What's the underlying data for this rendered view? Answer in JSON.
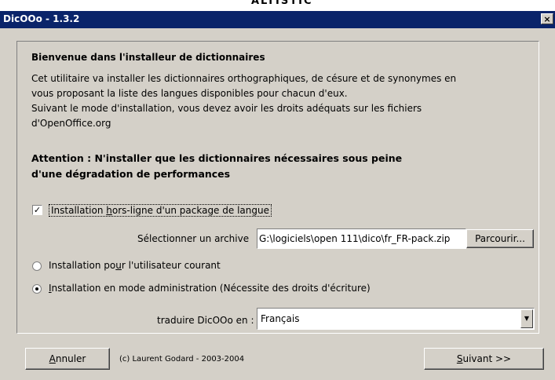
{
  "window": {
    "title": "DicOOo - 1.3.2",
    "close_label": "×",
    "top_strip_text": "ALTISTIC"
  },
  "main": {
    "heading": "Bienvenue dans l'installeur de dictionnaires",
    "description_lines": [
      "Cet utilitaire va installer les dictionnaires orthographiques, de césure et de synonymes en",
      "vous proposant la liste des langues disponibles pour chacun d'eux.",
      "Suivant le mode d'installation, vous devez avoir les droits adéquats sur les fichiers",
      "d'OpenOffice.org"
    ],
    "warning_lines": [
      "Attention : N'installer que les dictionnaires nécessaires sous peine",
      "d'une dégradation de performances"
    ]
  },
  "offline": {
    "checked": true,
    "label_pre": "Installation ",
    "label_mnemonic": "h",
    "label_post": "ors-ligne d'un package de langue",
    "select_archive_label": "Sélectionner un archive",
    "archive_path": "G:\\logiciels\\open 111\\dico\\fr_FR-pack.zip",
    "browse_label": "Parcourir..."
  },
  "install_mode": {
    "options": [
      {
        "pre": "Installation po",
        "mnemonic": "u",
        "post": "r l'utilisateur courant",
        "selected": false
      },
      {
        "pre": "",
        "mnemonic": "I",
        "post": "nstallation en mode administration (Nécessite des droits d'écriture)",
        "selected": true
      }
    ]
  },
  "language": {
    "label": "traduire DicOOo en :",
    "selected": "Français",
    "arrow_icon": "▼"
  },
  "footer": {
    "cancel_mnemonic": "A",
    "cancel_rest": "nnuler",
    "copyright": "(c) Laurent Godard - 2003-2004",
    "next_mnemonic": "S",
    "next_rest": "uivant >>"
  }
}
